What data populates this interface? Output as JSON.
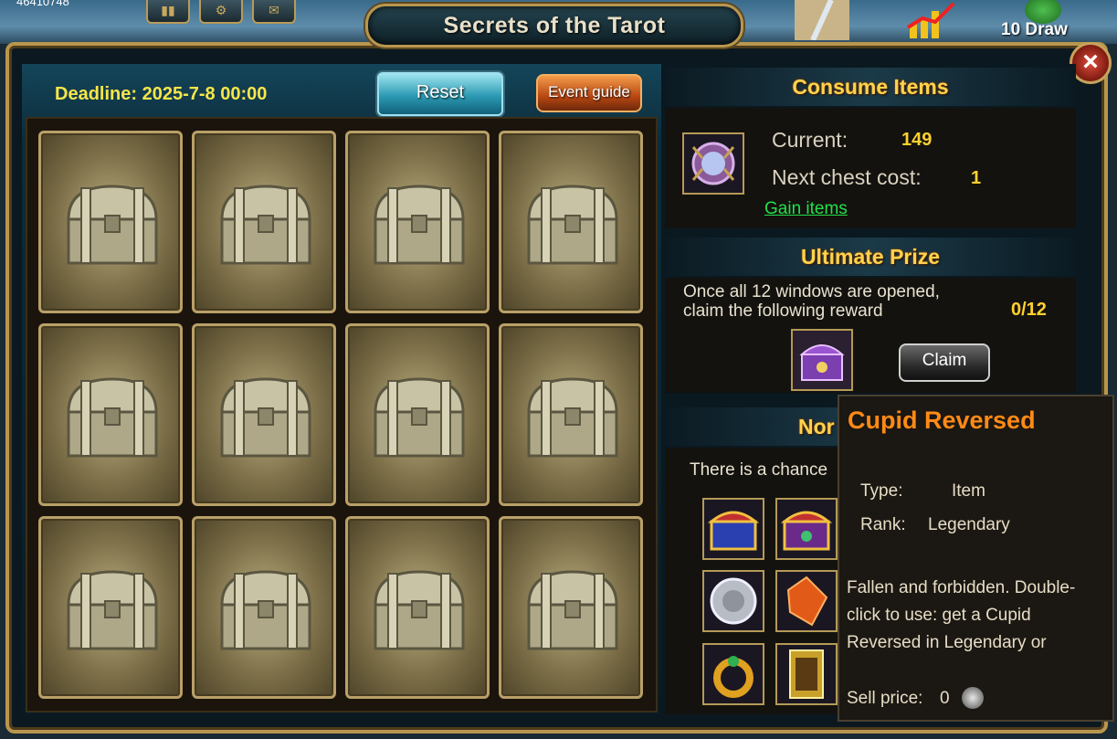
{
  "top_bar": {
    "coords_text": "46410748",
    "draw_label": "10 Draw",
    "buttons": [
      "menu-icon",
      "gear-icon",
      "mail-icon"
    ]
  },
  "window": {
    "title": "Secrets of the Tarot",
    "close_icon": "close-icon"
  },
  "left": {
    "deadline": "Deadline: 2025-7-8 00:00",
    "reset_label": "Reset",
    "guide_label": "Event guide",
    "chests": 12
  },
  "consume": {
    "heading": "Consume Items",
    "current_label": "Current:",
    "current_value": "149",
    "cost_label": "Next chest cost:",
    "cost_value": "1",
    "gain_link": "Gain items"
  },
  "ultimate": {
    "heading": "Ultimate Prize",
    "line1": "Once all 12 windows are opened,",
    "line2": "claim the following reward",
    "progress": "0/12",
    "claim_label": "Claim"
  },
  "normal": {
    "heading_visible": "Nor",
    "chance_text": "There is a chance"
  },
  "tooltip": {
    "title": "Cupid Reversed",
    "type_label": "Type:",
    "type_value": "Item",
    "rank_label": "Rank:",
    "rank_value": "Legendary",
    "description": "Fallen and forbidden. Double-click to use: get a Cupid Reversed in Legendary or",
    "sell_label": "Sell price:",
    "sell_value": "0"
  },
  "colors": {
    "heading": "#ffd34d",
    "value": "#ffd12e",
    "link": "#22e04a",
    "tooltip_title": "#ff8a16"
  }
}
